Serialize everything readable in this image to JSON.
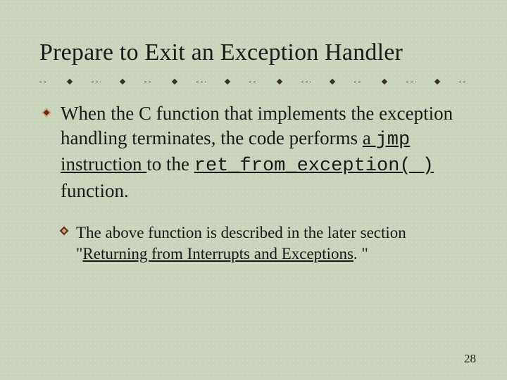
{
  "title": "Prepare to Exit an Exception Handler",
  "bullet_main": {
    "pre": "When the C function that implements the exception handling terminates, the code performs ",
    "link1_a": "a ",
    "link1_code": "jmp",
    "link1_b": " instruction ",
    "mid": "to the ",
    "link2_code": "ret_from_exception( )",
    "link2_suffix": " ",
    "post": "function."
  },
  "bullet_sub": {
    "pre": "The above function is described in the later section \"",
    "link": "Returning from Interrupts and Exceptions",
    "post": ". \""
  },
  "page_number": "28",
  "colors": {
    "accent_dark": "#6a2810",
    "accent_light": "#cbaa77"
  }
}
